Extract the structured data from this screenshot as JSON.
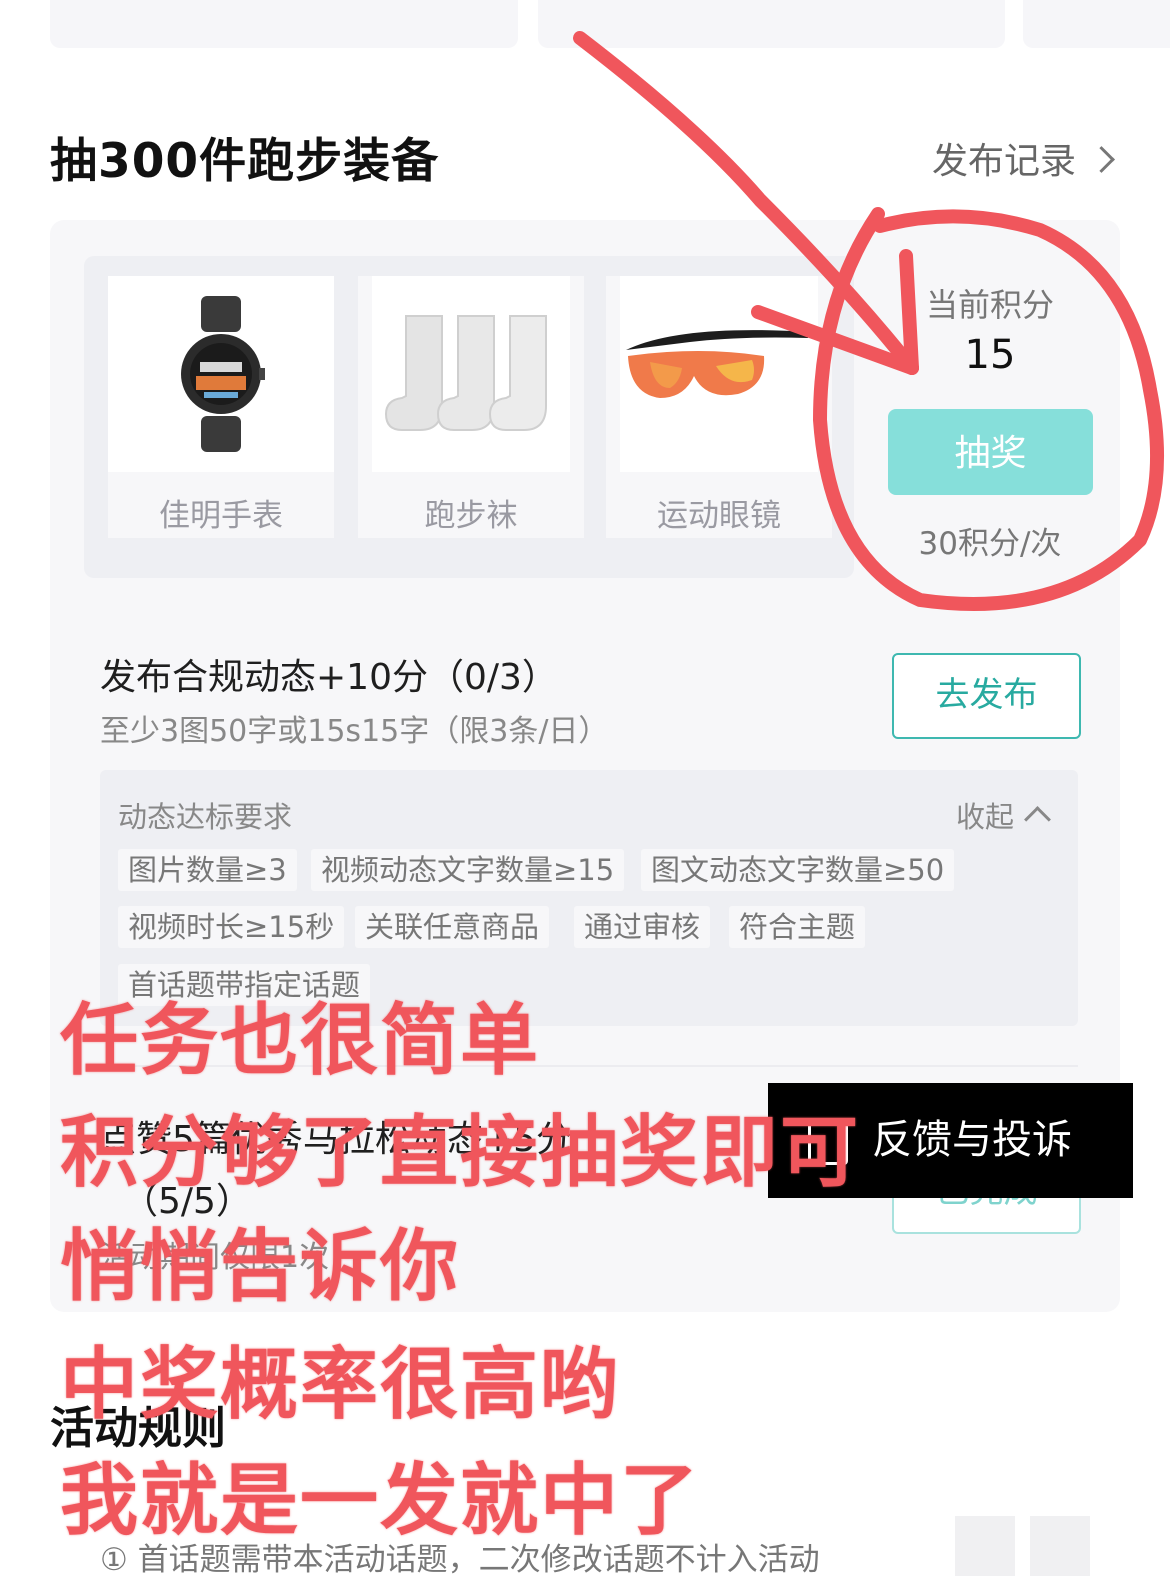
{
  "section": {
    "title": "抽300件跑步装备",
    "record_link": "发布记录"
  },
  "prizes": [
    {
      "name": "佳明手表",
      "icon": "watch-image"
    },
    {
      "name": "跑步袜",
      "icon": "socks-image"
    },
    {
      "name": "运动眼镜",
      "icon": "sunglasses-image"
    }
  ],
  "points": {
    "label": "当前积分",
    "value": "15",
    "draw_button": "抽奖",
    "cost": "30积分/次"
  },
  "task1": {
    "title": "发布合规动态+10分（0/3）",
    "subtitle": "至少3图50字或15s15字（限3条/日）",
    "button": "去发布"
  },
  "requirements": {
    "title": "动态达标要求",
    "collapse": "收起",
    "tags": [
      "图片数量≥3",
      "视频动态文字数量≥15",
      "图文动态文字数量≥50",
      "视频时长≥15秒",
      "关联任意商品",
      "通过审核",
      "符合主题",
      "首话题带指定话题"
    ]
  },
  "task2": {
    "title": "点赞5篇优秀马拉松动态+5分",
    "count": "（5/5）",
    "subtitle": "活动期间仅限1次",
    "button": "已完成"
  },
  "feedback": {
    "label": "反馈与投诉"
  },
  "rules": {
    "title": "活动规则",
    "item1": "① 首话题需带本活动话题，二次修改话题不计入活动"
  },
  "overlay": {
    "lines": [
      "任务也很简单",
      "积分够了直接抽奖即可",
      "悄悄告诉你",
      "中奖概率很高哟",
      "我就是一发就中了"
    ],
    "color": "#f0565c"
  },
  "colors": {
    "accent_teal": "#3eb8b0",
    "draw_button": "#86dfda",
    "annotation_red": "#f0565c"
  }
}
